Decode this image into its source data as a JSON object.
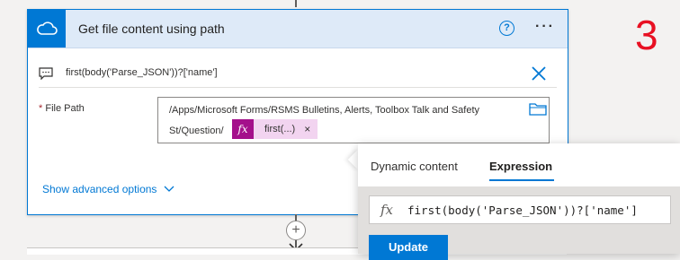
{
  "step_number": "3",
  "action_card": {
    "title": "Get file content using path",
    "icon": "cloud-icon",
    "help_label": "?",
    "more_label": "···",
    "comment": "first(body('Parse_JSON'))?['name']",
    "field": {
      "label": "File Path",
      "required_mark": "*",
      "path_line1": "/Apps/Microsoft Forms/RSMS Bulletins, Alerts, Toolbox Talk and Safety",
      "path_line2": "St/Question/",
      "token": {
        "fx": "fx",
        "label": "first(...)",
        "remove": "×"
      }
    },
    "advanced_options_label": "Show advanced options"
  },
  "popover": {
    "tabs": [
      "Dynamic content",
      "Expression"
    ],
    "active_tab": "Expression",
    "expression_fx": "fx",
    "expression": "first(body('Parse_JSON'))?['name']",
    "update_label": "Update"
  },
  "colors": {
    "accent": "#0078d4",
    "header_bg": "#deeaf8",
    "token_bg": "#f2d4f0",
    "token_fx_bg": "#a4108b",
    "step_number": "#e81123"
  }
}
